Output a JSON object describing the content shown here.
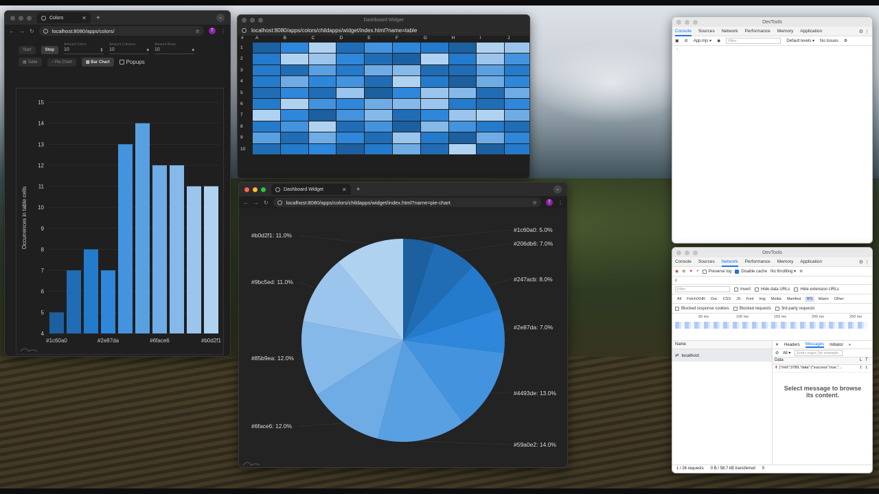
{
  "colors_window": {
    "tab_title": "Colors",
    "url": "localhost:8080/apps/colors/",
    "avatar": "T",
    "buttons": {
      "start": "Start",
      "stop": "Stop"
    },
    "fields": [
      {
        "label": "Amount Colors",
        "value": "10"
      },
      {
        "label": "Amount Columns",
        "value": "10"
      },
      {
        "label": "Amount Rows",
        "value": "10"
      }
    ],
    "view_buttons": [
      "Table",
      "Pie Chart",
      "Bar Chart"
    ],
    "popups_label": "Popups"
  },
  "table_window": {
    "title": "Dashboard Widget",
    "url": "localhost:8080/apps/colors/childapps/widget/index.html?name=table",
    "corner": "#",
    "columns": [
      "A",
      "B",
      "C",
      "D",
      "E",
      "F",
      "G",
      "H",
      "I",
      "J"
    ],
    "rows": [
      "1",
      "2",
      "3",
      "4",
      "5",
      "6",
      "7",
      "8",
      "9",
      "10"
    ],
    "cells": [
      [
        "#1c60a0",
        "#2e87da",
        "#b0d2f1",
        "#206db6",
        "#4493de",
        "#2e87da",
        "#247acb",
        "#1c60a0",
        "#b0d2f1",
        "#9bc5ed"
      ],
      [
        "#247acb",
        "#b0d2f1",
        "#9bc5ed",
        "#2e87da",
        "#206db6",
        "#1c60a0",
        "#b0d2f1",
        "#247acb",
        "#9bc5ed",
        "#4493de"
      ],
      [
        "#247acb",
        "#206db6",
        "#59a0e2",
        "#247acb",
        "#6face6",
        "#85b9ea",
        "#206db6",
        "#206db6",
        "#59a0e2",
        "#247acb"
      ],
      [
        "#247acb",
        "#6face6",
        "#2e87da",
        "#4493de",
        "#206db6",
        "#b0d2f1",
        "#247acb",
        "#1c60a0",
        "#6face6",
        "#2e87da"
      ],
      [
        "#206db6",
        "#2e87da",
        "#206db6",
        "#9bc5ed",
        "#1c60a0",
        "#2e87da",
        "#9bc5ed",
        "#85b9ea",
        "#206db6",
        "#6face6"
      ],
      [
        "#247acb",
        "#b0d2f1",
        "#4493de",
        "#2e87da",
        "#6face6",
        "#85b9ea",
        "#9bc5ed",
        "#247acb",
        "#206db6",
        "#2e87da"
      ],
      [
        "#b0d2f1",
        "#2e87da",
        "#1c60a0",
        "#4493de",
        "#85b9ea",
        "#206db6",
        "#2e87da",
        "#9bc5ed",
        "#b0d2f1",
        "#6face6"
      ],
      [
        "#247acb",
        "#4493de",
        "#b0d2f1",
        "#206db6",
        "#4493de",
        "#1c60a0",
        "#85b9ea",
        "#4493de",
        "#247acb",
        "#206db6"
      ],
      [
        "#59a0e2",
        "#206db6",
        "#6face6",
        "#2e87da",
        "#206db6",
        "#9bc5ed",
        "#247acb",
        "#1c60a0",
        "#6face6",
        "#2e87da"
      ],
      [
        "#206db6",
        "#247acb",
        "#2e87da",
        "#1c60a0",
        "#247acb",
        "#6face6",
        "#206db6",
        "#b0d2f1",
        "#1c60a0",
        "#247acb"
      ]
    ]
  },
  "pie_window": {
    "tab_title": "Dashboard Widget",
    "url": "localhost:8080/apps/colors/childapps/widget/index.html?name=pie-chart",
    "avatar": "T"
  },
  "chart_data": [
    {
      "type": "bar",
      "categories": [
        "#1c60a0",
        "#206db6",
        "#247acb",
        "#2e87da",
        "#4493de",
        "#59a0e2",
        "#6face6",
        "#85b9ea",
        "#9bc5ed",
        "#b0d2f1"
      ],
      "values": [
        5,
        7,
        8,
        7,
        13,
        14,
        12,
        12,
        11,
        11
      ],
      "tick_labels_shown": [
        "#1c60a0",
        "#2e87da",
        "#6face6",
        "#b0d2f1"
      ],
      "colors": [
        "#1c60a0",
        "#206db6",
        "#247acb",
        "#2e87da",
        "#4493de",
        "#59a0e2",
        "#6face6",
        "#85b9ea",
        "#9bc5ed",
        "#b0d2f1"
      ],
      "ylabel": "Occurrences in table cells",
      "ylim": [
        4,
        15
      ],
      "yticks": [
        4,
        5,
        6,
        7,
        8,
        9,
        10,
        11,
        12,
        13,
        14,
        15
      ],
      "grid": true
    },
    {
      "type": "pie",
      "slices": [
        {
          "label": "#1c60a0: 5.0%",
          "color": "#1c60a0",
          "value": 5.0
        },
        {
          "label": "#206db6: 7.0%",
          "color": "#206db6",
          "value": 7.0
        },
        {
          "label": "#247acb: 8.0%",
          "color": "#247acb",
          "value": 8.0
        },
        {
          "label": "#2e87da: 7.0%",
          "color": "#2e87da",
          "value": 7.0
        },
        {
          "label": "#4493de: 13.0%",
          "color": "#4493de",
          "value": 13.0
        },
        {
          "label": "#59a0e2: 14.0%",
          "color": "#59a0e2",
          "value": 14.0
        },
        {
          "label": "#6face6: 12.0%",
          "color": "#6face6",
          "value": 12.0
        },
        {
          "label": "#85b9ea: 12.0%",
          "color": "#85b9ea",
          "value": 12.0
        },
        {
          "label": "#9bc5ed: 11.0%",
          "color": "#9bc5ed",
          "value": 11.0
        },
        {
          "label": "#b0d2f1: 11.0%",
          "color": "#b0d2f1",
          "value": 11.0
        }
      ]
    }
  ],
  "devtools_top": {
    "title": "DevTools",
    "tabs": [
      "Console",
      "Sources",
      "Network",
      "Performance",
      "Memory",
      "Application"
    ],
    "context": "App.mjs",
    "filter_placeholder": "Filter",
    "levels": "Default levels",
    "issues": "No Issues"
  },
  "devtools_bottom": {
    "title": "DevTools",
    "tabs": [
      "Console",
      "Sources",
      "Network",
      "Performance",
      "Memory",
      "Application"
    ],
    "preserve_log": "Preserve log",
    "disable_cache": "Disable cache",
    "throttling": "No throttling",
    "filter_placeholder": "Filter",
    "invert": "Invert",
    "hide_data_urls": "Hide data URLs",
    "hide_ext_urls": "Hide extension URLs",
    "types": [
      "All",
      "Fetch/XHR",
      "Doc",
      "CSS",
      "JS",
      "Font",
      "Img",
      "Media",
      "Manifest",
      "WS",
      "Wasm",
      "Other"
    ],
    "blocked_cookies": "Blocked response cookies",
    "blocked_requests": "Blocked requests",
    "third_party": "3rd-party requests",
    "timeline": [
      "50 ms",
      "100 ms",
      "150 ms",
      "200 ms",
      "250 ms"
    ],
    "name_header": "Name",
    "request": "localhost",
    "detail_tabs": [
      "Headers",
      "Messages",
      "Initiator"
    ],
    "messages_filter": "All",
    "messages_placeholder": "Enter regex, for example",
    "data_header": "Data",
    "len_header": "L",
    "time_header": "T",
    "message_row": "{\"mId\":3789,\"data\":{\"success\":true,\"...",
    "message_len": "1",
    "message_time": "1.",
    "empty_text": "Select message to browse its content.",
    "status_requests": "1 / 26 requests",
    "status_transfer": "0 B / 58.7 kB transferred",
    "status_count": "0"
  }
}
